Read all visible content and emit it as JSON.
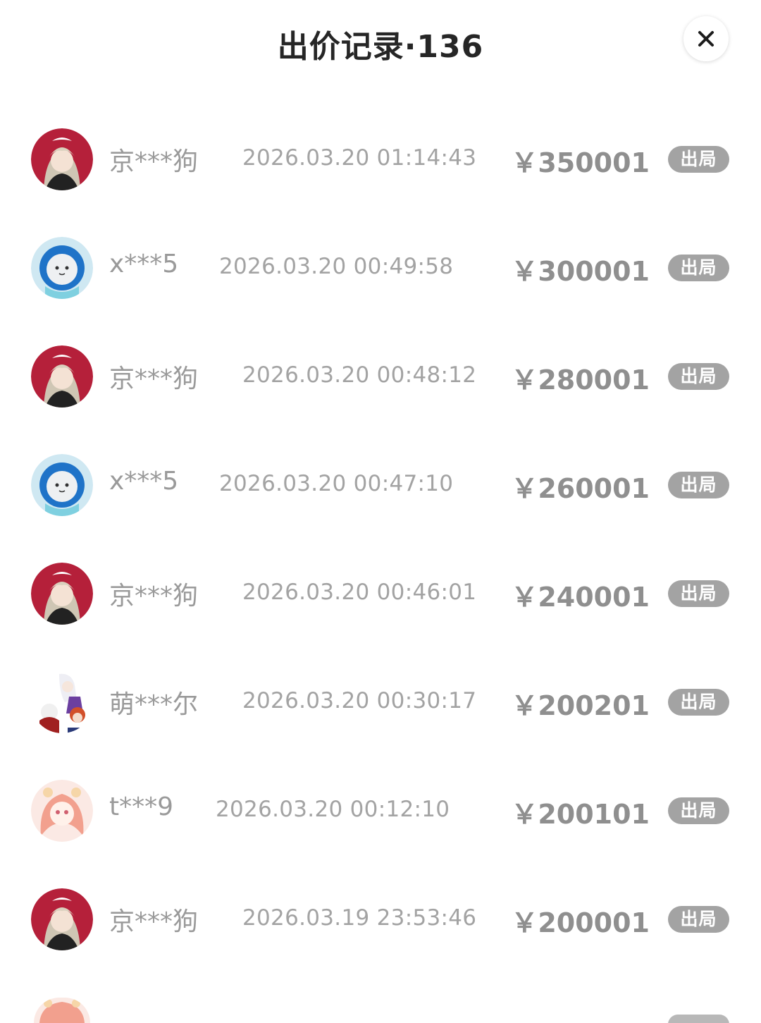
{
  "header": {
    "title": "出价记录·136",
    "close_icon": "close-icon"
  },
  "bids": [
    {
      "user": "京***狗",
      "time": "2026.03.20 01:14:43",
      "price": "￥350001",
      "status": "出局",
      "avatar": "maid-girl-avatar"
    },
    {
      "user": "x***5",
      "time": "2026.03.20 00:49:58",
      "price": "￥300001",
      "status": "出局",
      "avatar": "cat-astronaut-avatar"
    },
    {
      "user": "京***狗",
      "time": "2026.03.20 00:48:12",
      "price": "￥280001",
      "status": "出局",
      "avatar": "maid-girl-avatar"
    },
    {
      "user": "x***5",
      "time": "2026.03.20 00:47:10",
      "price": "￥260001",
      "status": "出局",
      "avatar": "cat-astronaut-avatar"
    },
    {
      "user": "京***狗",
      "time": "2026.03.20 00:46:01",
      "price": "￥240001",
      "status": "出局",
      "avatar": "maid-girl-avatar"
    },
    {
      "user": "萌***尔",
      "time": "2026.03.20 00:30:17",
      "price": "￥200201",
      "status": "出局",
      "avatar": "anime-group-avatar"
    },
    {
      "user": "t***9",
      "time": "2026.03.20 00:12:10",
      "price": "￥200101",
      "status": "出局",
      "avatar": "pink-hair-girl-avatar"
    },
    {
      "user": "京***狗",
      "time": "2026.03.19 23:53:46",
      "price": "￥200001",
      "status": "出局",
      "avatar": "maid-girl-avatar"
    }
  ],
  "colors": {
    "title": "#262626",
    "muted_text": "#9a9a9a",
    "badge_bg": "#a3a3a3",
    "badge_text": "#ffffff"
  }
}
